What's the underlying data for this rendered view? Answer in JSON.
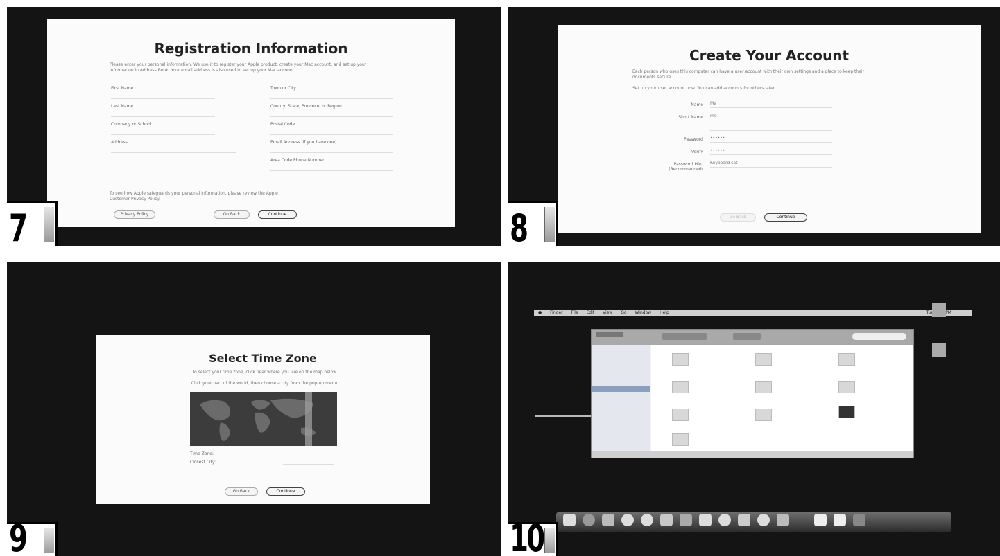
{
  "panels": [
    {
      "step": "7",
      "title": "Registration Information",
      "intro": "Please enter your personal information. We use it to register your Apple product, create your Mac account, and set up your information in Address Book. Your email address is also used to set up your Mac account.",
      "left_fields": [
        "First Name",
        "Last Name",
        "Company or School",
        "Address"
      ],
      "right_fields": [
        "Town or City",
        "County, State, Province, or Region",
        "Postal Code",
        "Email Address (if you have one)",
        "Area Code   Phone Number"
      ],
      "footnote": "To see how Apple safeguards your personal information, please review the Apple Customer Privacy Policy.",
      "buttons": [
        "Privacy Policy",
        "Go Back",
        "Continue"
      ]
    },
    {
      "step": "8",
      "title": "Create Your Account",
      "intro": "Each person who uses this computer can have a user account with their own settings and a place to keep their documents secure.",
      "intro2": "Set up your user account now. You can add accounts for others later.",
      "fields": [
        "Name",
        "Short Name",
        "Password",
        "Verify",
        "Password Hint (Recommended)"
      ],
      "values": [
        "Me",
        "me",
        "••••••",
        "••••••",
        "Keyboard cat"
      ],
      "buttons": [
        "Go Back",
        "Continue"
      ]
    },
    {
      "step": "9",
      "title": "Select Time Zone",
      "intro": "To select your time zone, click near where you live on the map below.",
      "intro2": "Click your part of the world, then choose a city from the pop-up menu.",
      "timezone_label": "Time Zone:",
      "closest_city_label": "Closest City:",
      "buttons": [
        "Go Back",
        "Continue"
      ]
    },
    {
      "step": "10",
      "menu_items": [
        "Finder",
        "File",
        "Edit",
        "View",
        "Go",
        "Window",
        "Help"
      ],
      "clock": "Tue 1:57 PM"
    }
  ]
}
